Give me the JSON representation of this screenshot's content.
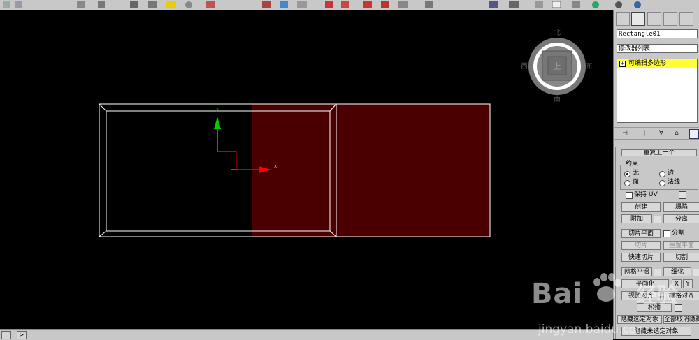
{
  "colors": {
    "viewport_bg": "#000000",
    "selected_face": "#4a0000",
    "wireframe": "#ffffff",
    "y_axis": "#00cc00",
    "x_axis": "#ff0000",
    "stack_highlight": "#ffff33",
    "panel_bg": "#c8c8c8"
  },
  "viewcube": {
    "face_label": "上",
    "north": "北",
    "south": "南",
    "east": "东",
    "west": "西"
  },
  "gizmo": {
    "x_label": "x",
    "y_label": "y"
  },
  "command_panel": {
    "tabs": [
      "create-tab",
      "modify-tab",
      "hierarchy-tab",
      "motion-tab",
      "display-tab"
    ],
    "object_name": "Rectangle01",
    "modifier_list_label": "修改器列表",
    "stack_item": "可编辑多边形",
    "stack_toggle": "+",
    "stack_icons": [
      "pin-stack-icon",
      "show-end-result-icon",
      "make-unique-icon",
      "remove-modifier-icon",
      "configure-modifier-sets-icon"
    ]
  },
  "edit_geometry": {
    "repeat_last": "重复上一个",
    "constraints_label": "约束",
    "constraint_none": "无",
    "constraint_edge": "边",
    "constraint_face": "面",
    "constraint_normal": "法线",
    "preserve_uv": "保持 UV",
    "create": "创建",
    "collapse": "塌陷",
    "attach": "附加",
    "detach": "分离",
    "slice_plane": "切片平面",
    "split": "分割",
    "slice": "切片",
    "reset_plane": "重置平面",
    "quickslice": "快速切片",
    "cut": "切割",
    "meshsmooth": "网格平滑",
    "tessellate": "细化",
    "make_planar": "平面化",
    "axis_x": "X",
    "axis_y": "Y",
    "view_align": "视图对齐",
    "grid_align": "栅格对齐",
    "relax": "松弛",
    "hide_selected": "隐藏选定对象",
    "unhide_all": "全部取消隐藏",
    "hide_unselected": "隐藏未选定对象"
  },
  "status": {
    "expand": ">"
  },
  "watermark": {
    "brand": "Bai",
    "brand_cn": "经验",
    "url": "jingyan.baidu.com"
  }
}
